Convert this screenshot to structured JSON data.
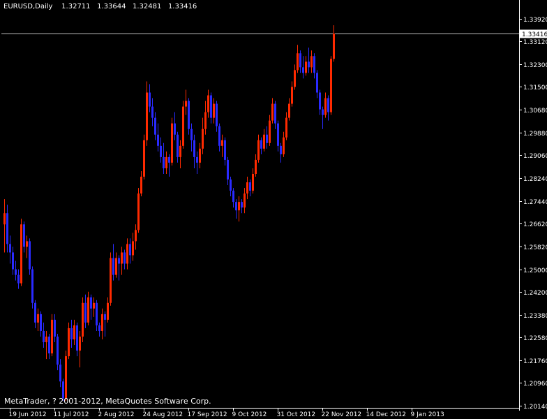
{
  "header": {
    "symbol": "EURUSD,Daily",
    "open": "1.32711",
    "high": "1.33644",
    "low": "1.32481",
    "close": "1.33416"
  },
  "footer": {
    "copyright": "MetaTrader, ? 2001-2012, MetaQuotes Software Corp."
  },
  "colors": {
    "background": "#000000",
    "axis": "#ffffff",
    "bull": "#ff2a00",
    "bear": "#2a2aff",
    "last_price_label_bg": "#ffffff",
    "last_price_label_fg": "#000000",
    "last_price_line": "#bfbfbf"
  },
  "chart_data": {
    "type": "candlestick",
    "title": "EURUSD,Daily",
    "last_price": 1.33416,
    "ylim": [
      1.2006,
      1.343
    ],
    "y_ticks": [
      1.3392,
      1.3312,
      1.323,
      1.315,
      1.3068,
      1.2988,
      1.2906,
      1.2824,
      1.2744,
      1.2662,
      1.2582,
      1.25,
      1.242,
      1.2338,
      1.2258,
      1.2176,
      1.2096,
      1.2014
    ],
    "y_tick_labels": [
      "1.33920",
      "1.33120",
      "1.32300",
      "1.31500",
      "1.30680",
      "1.29880",
      "1.29060",
      "1.28240",
      "1.27440",
      "1.26620",
      "1.25820",
      "1.25000",
      "1.24200",
      "1.23380",
      "1.22580",
      "1.21760",
      "1.20960",
      "1.20140"
    ],
    "x_tick_labels": [
      {
        "label": "19 Jun 2012",
        "bar": 2
      },
      {
        "label": "11 Jul 2012",
        "bar": 18
      },
      {
        "label": "2 Aug 2012",
        "bar": 34
      },
      {
        "label": "24 Aug 2012",
        "bar": 50
      },
      {
        "label": "17 Sep 2012",
        "bar": 66
      },
      {
        "label": "9 Oct 2012",
        "bar": 82
      },
      {
        "label": "31 Oct 2012",
        "bar": 98
      },
      {
        "label": "22 Nov 2012",
        "bar": 114
      },
      {
        "label": "14 Dec 2012",
        "bar": 130
      },
      {
        "label": "9 Jan 2013",
        "bar": 146
      }
    ],
    "grid": false,
    "candles_ohlc": [
      [
        1.266,
        1.275,
        1.256,
        1.27
      ],
      [
        1.27,
        1.273,
        1.256,
        1.259
      ],
      [
        1.259,
        1.262,
        1.252,
        1.256
      ],
      [
        1.256,
        1.258,
        1.248,
        1.25
      ],
      [
        1.25,
        1.253,
        1.246,
        1.248
      ],
      [
        1.248,
        1.25,
        1.243,
        1.245
      ],
      [
        1.245,
        1.268,
        1.244,
        1.266
      ],
      [
        1.266,
        1.267,
        1.256,
        1.258
      ],
      [
        1.258,
        1.262,
        1.254,
        1.26
      ],
      [
        1.26,
        1.261,
        1.248,
        1.25
      ],
      [
        1.25,
        1.251,
        1.236,
        1.238
      ],
      [
        1.238,
        1.239,
        1.229,
        1.231
      ],
      [
        1.231,
        1.236,
        1.228,
        1.234
      ],
      [
        1.234,
        1.235,
        1.226,
        1.228
      ],
      [
        1.228,
        1.231,
        1.222,
        1.224
      ],
      [
        1.224,
        1.228,
        1.218,
        1.226
      ],
      [
        1.226,
        1.227,
        1.218,
        1.22
      ],
      [
        1.22,
        1.234,
        1.219,
        1.232
      ],
      [
        1.232,
        1.234,
        1.224,
        1.226
      ],
      [
        1.226,
        1.227,
        1.214,
        1.216
      ],
      [
        1.216,
        1.218,
        1.208,
        1.21
      ],
      [
        1.21,
        1.211,
        1.203,
        1.204
      ],
      [
        1.204,
        1.221,
        1.203,
        1.219
      ],
      [
        1.219,
        1.231,
        1.218,
        1.229
      ],
      [
        1.229,
        1.232,
        1.222,
        1.225
      ],
      [
        1.225,
        1.232,
        1.223,
        1.23
      ],
      [
        1.23,
        1.231,
        1.219,
        1.221
      ],
      [
        1.221,
        1.228,
        1.215,
        1.226
      ],
      [
        1.226,
        1.24,
        1.224,
        1.238
      ],
      [
        1.238,
        1.241,
        1.229,
        1.231
      ],
      [
        1.231,
        1.242,
        1.23,
        1.24
      ],
      [
        1.24,
        1.241,
        1.232,
        1.236
      ],
      [
        1.236,
        1.24,
        1.233,
        1.238
      ],
      [
        1.238,
        1.239,
        1.228,
        1.23
      ],
      [
        1.23,
        1.231,
        1.226,
        1.228
      ],
      [
        1.228,
        1.236,
        1.225,
        1.234
      ],
      [
        1.234,
        1.235,
        1.226,
        1.232
      ],
      [
        1.232,
        1.24,
        1.231,
        1.238
      ],
      [
        1.238,
        1.256,
        1.237,
        1.254
      ],
      [
        1.254,
        1.259,
        1.246,
        1.248
      ],
      [
        1.248,
        1.256,
        1.247,
        1.254
      ],
      [
        1.254,
        1.255,
        1.246,
        1.252
      ],
      [
        1.252,
        1.258,
        1.248,
        1.256
      ],
      [
        1.256,
        1.257,
        1.25,
        1.252
      ],
      [
        1.252,
        1.261,
        1.25,
        1.259
      ],
      [
        1.259,
        1.261,
        1.252,
        1.255
      ],
      [
        1.255,
        1.263,
        1.253,
        1.26
      ],
      [
        1.26,
        1.266,
        1.257,
        1.264
      ],
      [
        1.264,
        1.279,
        1.263,
        1.277
      ],
      [
        1.277,
        1.285,
        1.276,
        1.283
      ],
      [
        1.283,
        1.298,
        1.282,
        1.296
      ],
      [
        1.296,
        1.317,
        1.294,
        1.313
      ],
      [
        1.313,
        1.316,
        1.306,
        1.308
      ],
      [
        1.308,
        1.311,
        1.301,
        1.304
      ],
      [
        1.304,
        1.306,
        1.296,
        1.298
      ],
      [
        1.298,
        1.302,
        1.292,
        1.294
      ],
      [
        1.294,
        1.297,
        1.288,
        1.29
      ],
      [
        1.29,
        1.295,
        1.284,
        1.286
      ],
      [
        1.286,
        1.292,
        1.284,
        1.29
      ],
      [
        1.29,
        1.291,
        1.283,
        1.288
      ],
      [
        1.288,
        1.304,
        1.287,
        1.302
      ],
      [
        1.302,
        1.306,
        1.296,
        1.298
      ],
      [
        1.298,
        1.299,
        1.288,
        1.29
      ],
      [
        1.29,
        1.296,
        1.286,
        1.294
      ],
      [
        1.294,
        1.31,
        1.293,
        1.308
      ],
      [
        1.308,
        1.314,
        1.305,
        1.31
      ],
      [
        1.31,
        1.311,
        1.298,
        1.3
      ],
      [
        1.3,
        1.302,
        1.292,
        1.296
      ],
      [
        1.296,
        1.298,
        1.286,
        1.29
      ],
      [
        1.29,
        1.292,
        1.284,
        1.288
      ],
      [
        1.288,
        1.295,
        1.286,
        1.293
      ],
      [
        1.293,
        1.304,
        1.291,
        1.3
      ],
      [
        1.3,
        1.31,
        1.298,
        1.306
      ],
      [
        1.306,
        1.314,
        1.304,
        1.312
      ],
      [
        1.312,
        1.313,
        1.302,
        1.304
      ],
      [
        1.304,
        1.311,
        1.302,
        1.309
      ],
      [
        1.309,
        1.31,
        1.299,
        1.301
      ],
      [
        1.301,
        1.302,
        1.292,
        1.294
      ],
      [
        1.294,
        1.298,
        1.29,
        1.296
      ],
      [
        1.296,
        1.297,
        1.287,
        1.289
      ],
      [
        1.289,
        1.29,
        1.28,
        1.282
      ],
      [
        1.282,
        1.283,
        1.276,
        1.278
      ],
      [
        1.278,
        1.279,
        1.272,
        1.274
      ],
      [
        1.274,
        1.275,
        1.268,
        1.271
      ],
      [
        1.271,
        1.276,
        1.267,
        1.274
      ],
      [
        1.274,
        1.275,
        1.27,
        1.272
      ],
      [
        1.272,
        1.279,
        1.27,
        1.277
      ],
      [
        1.277,
        1.283,
        1.275,
        1.281
      ],
      [
        1.281,
        1.282,
        1.276,
        1.278
      ],
      [
        1.278,
        1.286,
        1.277,
        1.284
      ],
      [
        1.284,
        1.291,
        1.283,
        1.289
      ],
      [
        1.289,
        1.298,
        1.288,
        1.296
      ],
      [
        1.296,
        1.297,
        1.291,
        1.293
      ],
      [
        1.293,
        1.3,
        1.292,
        1.298
      ],
      [
        1.298,
        1.301,
        1.293,
        1.295
      ],
      [
        1.295,
        1.305,
        1.294,
        1.303
      ],
      [
        1.303,
        1.311,
        1.302,
        1.309
      ],
      [
        1.309,
        1.31,
        1.3,
        1.302
      ],
      [
        1.302,
        1.303,
        1.292,
        1.294
      ],
      [
        1.294,
        1.295,
        1.288,
        1.291
      ],
      [
        1.291,
        1.299,
        1.29,
        1.297
      ],
      [
        1.297,
        1.306,
        1.296,
        1.304
      ],
      [
        1.304,
        1.311,
        1.303,
        1.309
      ],
      [
        1.309,
        1.317,
        1.308,
        1.315
      ],
      [
        1.315,
        1.323,
        1.314,
        1.321
      ],
      [
        1.321,
        1.33,
        1.32,
        1.327
      ],
      [
        1.327,
        1.328,
        1.32,
        1.322
      ],
      [
        1.322,
        1.326,
        1.318,
        1.32
      ],
      [
        1.32,
        1.326,
        1.319,
        1.324
      ],
      [
        1.324,
        1.329,
        1.32,
        1.322
      ],
      [
        1.322,
        1.328,
        1.32,
        1.326
      ],
      [
        1.326,
        1.327,
        1.318,
        1.32
      ],
      [
        1.32,
        1.321,
        1.311,
        1.313
      ],
      [
        1.313,
        1.314,
        1.305,
        1.307
      ],
      [
        1.307,
        1.308,
        1.3,
        1.305
      ],
      [
        1.305,
        1.313,
        1.304,
        1.311
      ],
      [
        1.311,
        1.312,
        1.303,
        1.306
      ],
      [
        1.306,
        1.326,
        1.305,
        1.325
      ],
      [
        1.325,
        1.337,
        1.324,
        1.334
      ]
    ]
  }
}
